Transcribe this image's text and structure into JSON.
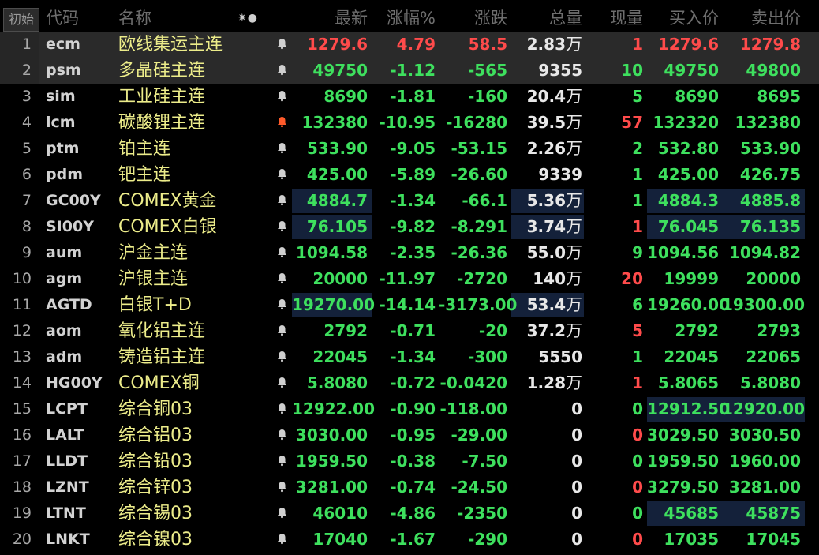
{
  "header": {
    "init_button": "初始",
    "columns": {
      "code": "代码",
      "name": "名称",
      "latest": "最新",
      "pct": "涨幅%",
      "chg": "涨跌",
      "vol": "总量",
      "cur": "现量",
      "bid": "买入价",
      "ask": "卖出价"
    },
    "icons": "gear-icon, dot-icon"
  },
  "colors": {
    "up": "#ff4b4b",
    "down": "#3ee05e",
    "name": "#ecec8a",
    "highlight": "#14213a",
    "bell_alert": "#ff5a2a"
  },
  "rows": [
    {
      "num": "1",
      "code": "ecm",
      "name": "欧线集运主连",
      "latest": "1279.6",
      "pct": "4.79",
      "chg": "58.5",
      "vol": "2.83",
      "vol_unit": "万",
      "cur": "1",
      "bid": "1279.6",
      "ask": "1279.8",
      "up": true,
      "cur_up": true,
      "selected": true,
      "bell_alert": false,
      "hl_latest": false,
      "hl_vol": false,
      "hl_quote": false
    },
    {
      "num": "2",
      "code": "psm",
      "name": "多晶硅主连",
      "latest": "49750",
      "pct": "-1.12",
      "chg": "-565",
      "vol": "9355",
      "vol_unit": "",
      "cur": "10",
      "bid": "49750",
      "ask": "49800",
      "up": false,
      "cur_up": false,
      "selected": true,
      "bell_alert": false,
      "hl_latest": false,
      "hl_vol": false,
      "hl_quote": false
    },
    {
      "num": "3",
      "code": "sim",
      "name": "工业硅主连",
      "latest": "8690",
      "pct": "-1.81",
      "chg": "-160",
      "vol": "20.4",
      "vol_unit": "万",
      "cur": "5",
      "bid": "8690",
      "ask": "8695",
      "up": false,
      "cur_up": false,
      "selected": false,
      "bell_alert": false,
      "hl_latest": false,
      "hl_vol": false,
      "hl_quote": false
    },
    {
      "num": "4",
      "code": "lcm",
      "name": "碳酸锂主连",
      "latest": "132380",
      "pct": "-10.95",
      "chg": "-16280",
      "vol": "39.5",
      "vol_unit": "万",
      "cur": "57",
      "bid": "132320",
      "ask": "132380",
      "up": false,
      "cur_up": true,
      "selected": false,
      "bell_alert": true,
      "hl_latest": false,
      "hl_vol": false,
      "hl_quote": false
    },
    {
      "num": "5",
      "code": "ptm",
      "name": "铂主连",
      "latest": "533.90",
      "pct": "-9.05",
      "chg": "-53.15",
      "vol": "2.26",
      "vol_unit": "万",
      "cur": "2",
      "bid": "532.80",
      "ask": "533.90",
      "up": false,
      "cur_up": false,
      "selected": false,
      "bell_alert": false,
      "hl_latest": false,
      "hl_vol": false,
      "hl_quote": false
    },
    {
      "num": "6",
      "code": "pdm",
      "name": "钯主连",
      "latest": "425.00",
      "pct": "-5.89",
      "chg": "-26.60",
      "vol": "9339",
      "vol_unit": "",
      "cur": "1",
      "bid": "425.00",
      "ask": "426.75",
      "up": false,
      "cur_up": false,
      "selected": false,
      "bell_alert": false,
      "hl_latest": false,
      "hl_vol": false,
      "hl_quote": false
    },
    {
      "num": "7",
      "code": "GC00Y",
      "name": "COMEX黄金",
      "latest": "4884.7",
      "pct": "-1.34",
      "chg": "-66.1",
      "vol": "5.36",
      "vol_unit": "万",
      "cur": "1",
      "bid": "4884.3",
      "ask": "4885.8",
      "up": false,
      "cur_up": false,
      "selected": false,
      "bell_alert": false,
      "hl_latest": true,
      "hl_vol": true,
      "hl_quote": true
    },
    {
      "num": "8",
      "code": "SI00Y",
      "name": "COMEX白银",
      "latest": "76.105",
      "pct": "-9.82",
      "chg": "-8.291",
      "vol": "3.74",
      "vol_unit": "万",
      "cur": "1",
      "bid": "76.045",
      "ask": "76.135",
      "up": false,
      "cur_up": true,
      "selected": false,
      "bell_alert": false,
      "hl_latest": true,
      "hl_vol": true,
      "hl_quote": true
    },
    {
      "num": "9",
      "code": "aum",
      "name": "沪金主连",
      "latest": "1094.58",
      "pct": "-2.35",
      "chg": "-26.36",
      "vol": "55.0",
      "vol_unit": "万",
      "cur": "9",
      "bid": "1094.56",
      "ask": "1094.82",
      "up": false,
      "cur_up": false,
      "selected": false,
      "bell_alert": false,
      "hl_latest": false,
      "hl_vol": false,
      "hl_quote": false
    },
    {
      "num": "10",
      "code": "agm",
      "name": "沪银主连",
      "latest": "20000",
      "pct": "-11.97",
      "chg": "-2720",
      "vol": "140",
      "vol_unit": "万",
      "cur": "20",
      "bid": "19999",
      "ask": "20000",
      "up": false,
      "cur_up": true,
      "selected": false,
      "bell_alert": false,
      "hl_latest": false,
      "hl_vol": false,
      "hl_quote": false
    },
    {
      "num": "11",
      "code": "AGTD",
      "name": "白银T+D",
      "latest": "19270.00",
      "pct": "-14.14",
      "chg": "-3173.00",
      "vol": "53.4",
      "vol_unit": "万",
      "cur": "6",
      "bid": "19260.00",
      "ask": "19300.00",
      "up": false,
      "cur_up": false,
      "selected": false,
      "bell_alert": false,
      "hl_latest": true,
      "hl_vol": true,
      "hl_quote": false
    },
    {
      "num": "12",
      "code": "aom",
      "name": "氧化铝主连",
      "latest": "2792",
      "pct": "-0.71",
      "chg": "-20",
      "vol": "37.2",
      "vol_unit": "万",
      "cur": "5",
      "bid": "2792",
      "ask": "2793",
      "up": false,
      "cur_up": true,
      "selected": false,
      "bell_alert": false,
      "hl_latest": false,
      "hl_vol": false,
      "hl_quote": false
    },
    {
      "num": "13",
      "code": "adm",
      "name": "铸造铝主连",
      "latest": "22045",
      "pct": "-1.34",
      "chg": "-300",
      "vol": "5550",
      "vol_unit": "",
      "cur": "1",
      "bid": "22045",
      "ask": "22065",
      "up": false,
      "cur_up": false,
      "selected": false,
      "bell_alert": false,
      "hl_latest": false,
      "hl_vol": false,
      "hl_quote": false
    },
    {
      "num": "14",
      "code": "HG00Y",
      "name": "COMEX铜",
      "latest": "5.8080",
      "pct": "-0.72",
      "chg": "-0.0420",
      "vol": "1.28",
      "vol_unit": "万",
      "cur": "1",
      "bid": "5.8065",
      "ask": "5.8080",
      "up": false,
      "cur_up": true,
      "selected": false,
      "bell_alert": false,
      "hl_latest": false,
      "hl_vol": false,
      "hl_quote": false
    },
    {
      "num": "15",
      "code": "LCPT",
      "name": "综合铜03",
      "latest": "12922.00",
      "pct": "-0.90",
      "chg": "-118.00",
      "vol": "0",
      "vol_unit": "",
      "cur": "0",
      "bid": "12912.50",
      "ask": "12920.00",
      "up": false,
      "cur_up": false,
      "selected": false,
      "bell_alert": false,
      "hl_latest": false,
      "hl_vol": false,
      "hl_quote": true
    },
    {
      "num": "16",
      "code": "LALT",
      "name": "综合铝03",
      "latest": "3030.00",
      "pct": "-0.95",
      "chg": "-29.00",
      "vol": "0",
      "vol_unit": "",
      "cur": "0",
      "bid": "3029.50",
      "ask": "3030.50",
      "up": false,
      "cur_up": true,
      "selected": false,
      "bell_alert": false,
      "hl_latest": false,
      "hl_vol": false,
      "hl_quote": false
    },
    {
      "num": "17",
      "code": "LLDT",
      "name": "综合铅03",
      "latest": "1959.50",
      "pct": "-0.38",
      "chg": "-7.50",
      "vol": "0",
      "vol_unit": "",
      "cur": "0",
      "bid": "1959.50",
      "ask": "1960.00",
      "up": false,
      "cur_up": false,
      "selected": false,
      "bell_alert": false,
      "hl_latest": false,
      "hl_vol": false,
      "hl_quote": false
    },
    {
      "num": "18",
      "code": "LZNT",
      "name": "综合锌03",
      "latest": "3281.00",
      "pct": "-0.74",
      "chg": "-24.50",
      "vol": "0",
      "vol_unit": "",
      "cur": "0",
      "bid": "3279.50",
      "ask": "3281.00",
      "up": false,
      "cur_up": true,
      "selected": false,
      "bell_alert": false,
      "hl_latest": false,
      "hl_vol": false,
      "hl_quote": false
    },
    {
      "num": "19",
      "code": "LTNT",
      "name": "综合锡03",
      "latest": "46010",
      "pct": "-4.86",
      "chg": "-2350",
      "vol": "0",
      "vol_unit": "",
      "cur": "0",
      "bid": "45685",
      "ask": "45875",
      "up": false,
      "cur_up": false,
      "selected": false,
      "bell_alert": false,
      "hl_latest": false,
      "hl_vol": false,
      "hl_quote": true
    },
    {
      "num": "20",
      "code": "LNKT",
      "name": "综合镍03",
      "latest": "17040",
      "pct": "-1.67",
      "chg": "-290",
      "vol": "0",
      "vol_unit": "",
      "cur": "0",
      "bid": "17035",
      "ask": "17045",
      "up": false,
      "cur_up": true,
      "selected": false,
      "bell_alert": false,
      "hl_latest": false,
      "hl_vol": false,
      "hl_quote": false
    }
  ]
}
